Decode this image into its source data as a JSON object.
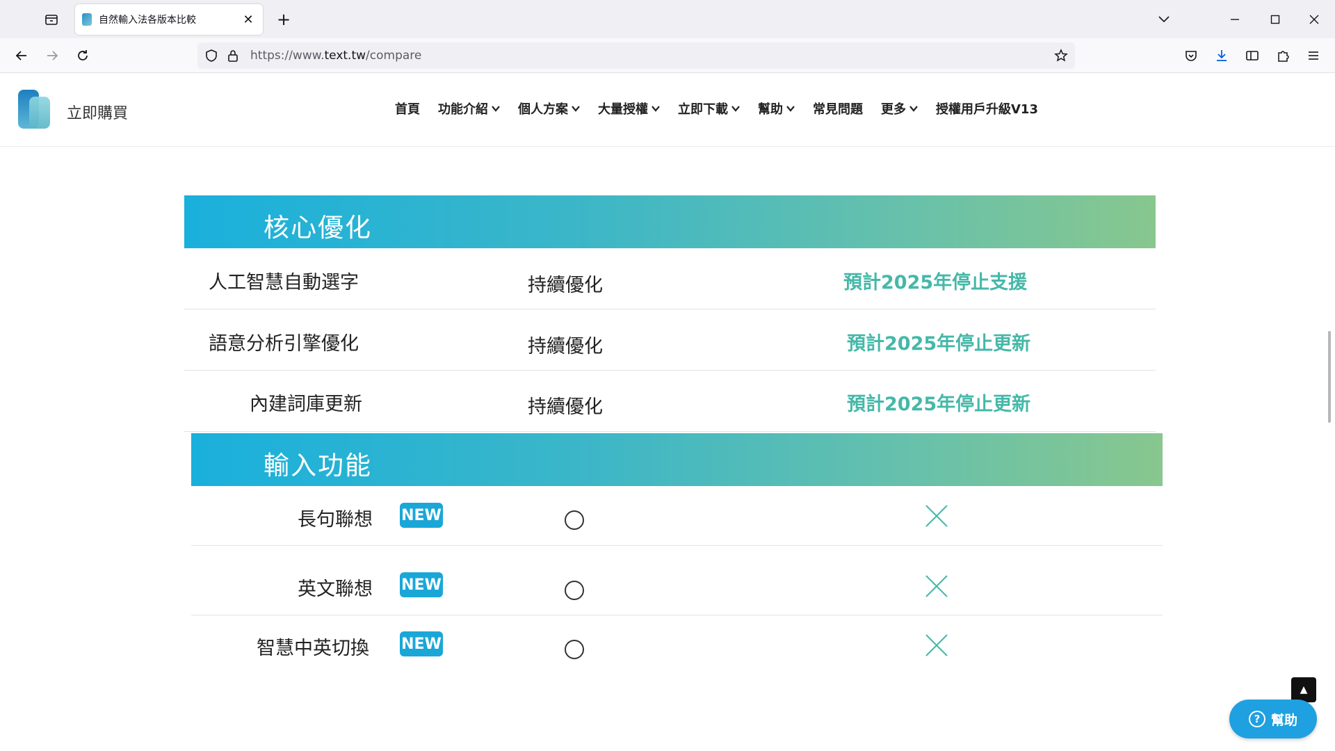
{
  "browser": {
    "tab_title": "自然輸入法各版本比較",
    "url_prefix": "https://www.",
    "url_domain": "text.tw",
    "url_path": "/compare"
  },
  "site": {
    "buy_now": "立即購買",
    "nav": [
      {
        "label": "首頁",
        "dropdown": false
      },
      {
        "label": "功能介紹",
        "dropdown": true
      },
      {
        "label": "個人方案",
        "dropdown": true
      },
      {
        "label": "大量授權",
        "dropdown": true
      },
      {
        "label": "立即下載",
        "dropdown": true
      },
      {
        "label": "幫助",
        "dropdown": true
      },
      {
        "label": "常見問題",
        "dropdown": false
      },
      {
        "label": "更多",
        "dropdown": true
      },
      {
        "label": "授權用戶升級V13",
        "dropdown": false
      }
    ]
  },
  "sections": [
    {
      "title": "核心優化",
      "rows": [
        {
          "feature": "人工智慧自動選字",
          "middle": "持續優化",
          "right": "預計2025年停止支援"
        },
        {
          "feature": "語意分析引擎優化",
          "middle": "持續優化",
          "right": "預計2025年停止更新"
        },
        {
          "feature": "內建詞庫更新",
          "middle": "持續優化",
          "right": "預計2025年停止更新"
        }
      ]
    },
    {
      "title": "輸入功能",
      "rows": [
        {
          "feature": "長句聯想",
          "badge": "NEW"
        },
        {
          "feature": "英文聯想",
          "badge": "NEW"
        },
        {
          "feature": "智慧中英切換",
          "badge": "NEW"
        }
      ]
    }
  ],
  "widgets": {
    "help_label": "幫助"
  },
  "colors": {
    "accent_teal": "#45b8a8",
    "badge_blue": "#1aa7d8",
    "help_blue": "#1fa0e0"
  }
}
